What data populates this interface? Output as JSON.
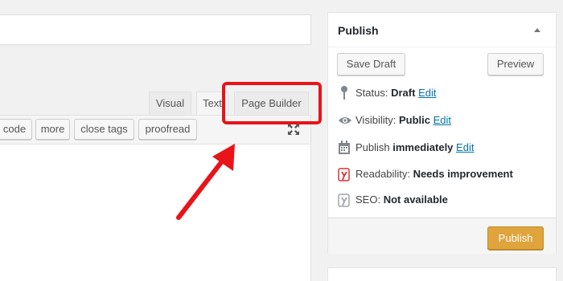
{
  "editor": {
    "tabs": {
      "visual": "Visual",
      "text": "Text",
      "page_builder": "Page Builder"
    },
    "quicktags": [
      "code",
      "more",
      "close tags",
      "proofread"
    ],
    "fullscreen_icon": "fullscreen-icon"
  },
  "publish_box": {
    "title": "Publish",
    "toggle_icon": "triangle-up-icon",
    "save_draft": "Save Draft",
    "preview": "Preview",
    "status": {
      "label": "Status:",
      "value": "Draft",
      "link": "Edit"
    },
    "visibility": {
      "label": "Visibility:",
      "value": "Public",
      "link": "Edit"
    },
    "schedule": {
      "label": "Publish",
      "value": "immediately",
      "link": "Edit"
    },
    "readability": {
      "label": "Readability:",
      "value": "Needs improvement"
    },
    "seo": {
      "label": "SEO:",
      "value": "Not available"
    },
    "publish_button": "Publish"
  },
  "colors": {
    "highlight": "#e8141a",
    "publish_button": "#e0a43d",
    "link": "#0073aa"
  }
}
